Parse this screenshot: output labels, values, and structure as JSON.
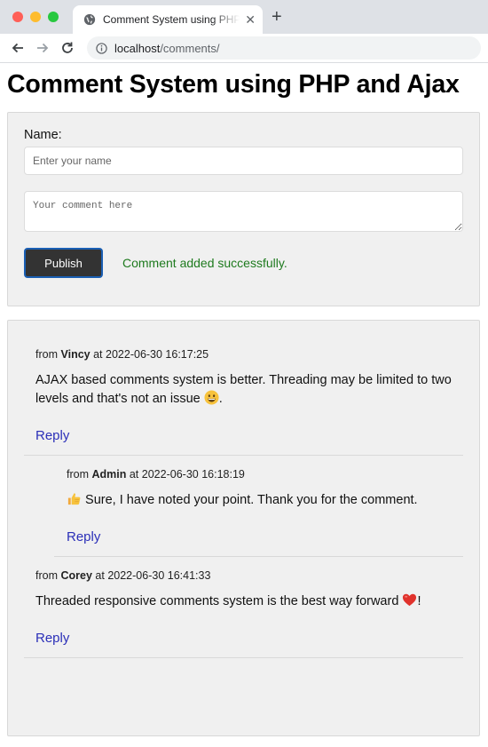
{
  "browser": {
    "tab_title": "Comment System using PHP and Ajax",
    "url_host": "localhost",
    "url_path": "/comments/",
    "colors": {
      "close": "#ff5f57",
      "minimize": "#febc2e",
      "maximize": "#28c840"
    }
  },
  "page": {
    "title": "Comment System using PHP and Ajax"
  },
  "form": {
    "name_label": "Name:",
    "name_placeholder": "Enter your name",
    "name_value": "",
    "comment_placeholder": "Your comment here",
    "comment_value": "",
    "publish_label": "Publish",
    "success_message": "Comment added successfully."
  },
  "comments": [
    {
      "from_prefix": "from",
      "author": "Vincy",
      "at_word": "at",
      "date": "2022-06-30 16:17:25",
      "text": "AJAX based comments system is better. Threading may be limited to two levels and that's not an issue",
      "emoji": "grinning-face",
      "reply_label": "Reply",
      "replies": [
        {
          "from_prefix": "from",
          "author": "Admin",
          "at_word": "at",
          "date": "2022-06-30 16:18:19",
          "emoji_lead": "thumbs-up",
          "text": "Sure, I have noted your point. Thank you for the comment.",
          "reply_label": "Reply"
        }
      ]
    },
    {
      "from_prefix": "from",
      "author": "Corey",
      "at_word": "at",
      "date": "2022-06-30 16:41:33",
      "text": "Threaded responsive comments system is the best way forward",
      "emoji": "red-heart",
      "text_suffix": "!",
      "reply_label": "Reply",
      "replies": []
    }
  ]
}
